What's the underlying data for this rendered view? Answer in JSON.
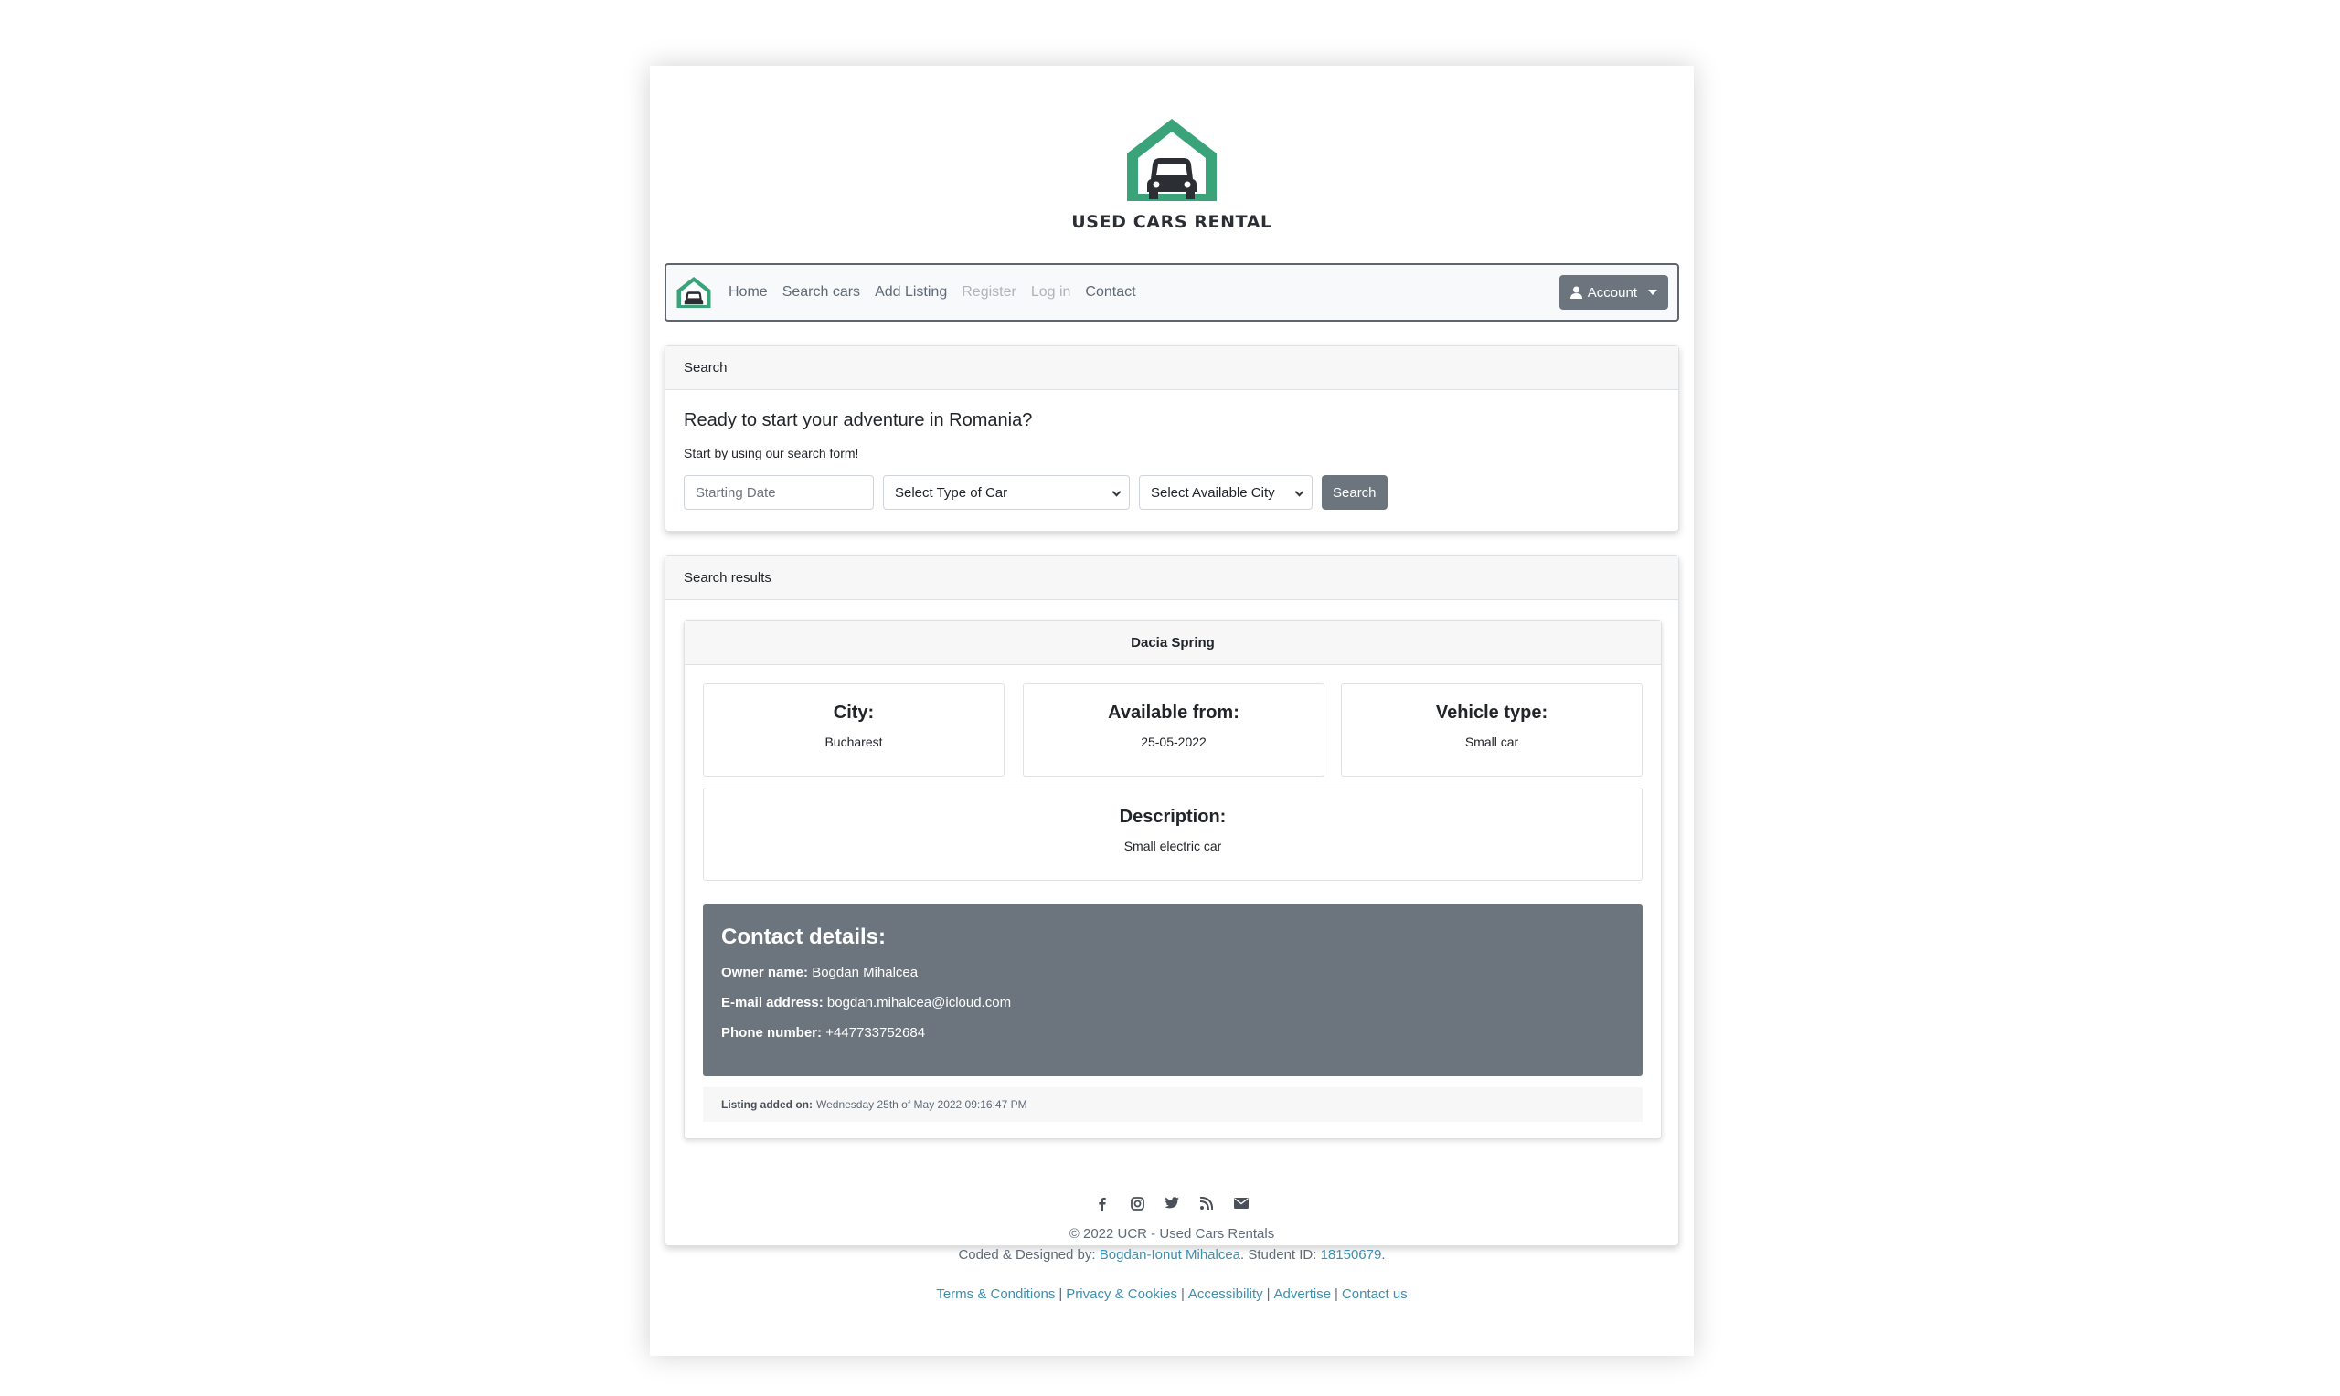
{
  "brand": {
    "name": "USED CARS RENTAL"
  },
  "colors": {
    "brand_green": "#3aa37a",
    "secondary": "#6c757d",
    "link": "#3e8fb0"
  },
  "navbar": {
    "items": [
      {
        "label": "Home",
        "disabled": false
      },
      {
        "label": "Search cars",
        "disabled": false
      },
      {
        "label": "Add Listing",
        "disabled": false
      },
      {
        "label": "Register",
        "disabled": true
      },
      {
        "label": "Log in",
        "disabled": true
      },
      {
        "label": "Contact",
        "disabled": false
      }
    ],
    "account_label": "Account",
    "account_icon": "user-icon"
  },
  "search": {
    "header": "Search",
    "title": "Ready to start your adventure in Romania?",
    "subtitle": "Start by using our search form!",
    "date_placeholder": "Starting Date",
    "car_type_selected": "Select Type of Car",
    "city_selected": "Select Available City",
    "button": "Search"
  },
  "results": {
    "header": "Search results",
    "listing": {
      "title": "Dacia Spring",
      "city_label": "City:",
      "city": "Bucharest",
      "available_label": "Available from:",
      "available": "25-05-2022",
      "type_label": "Vehicle type:",
      "type": "Small car",
      "description_label": "Description:",
      "description": "Small electric car",
      "contact": {
        "title": "Contact details:",
        "owner_label": "Owner name:",
        "owner": "Bogdan Mihalcea",
        "email_label": "E-mail address:",
        "email": "bogdan.mihalcea@icloud.com",
        "phone_label": "Phone number:",
        "phone": "+447733752684"
      },
      "added_label": "Listing added on:",
      "added": "Wednesday 25th of May 2022 09:16:47 PM"
    }
  },
  "footer": {
    "social_icons": [
      "facebook-icon",
      "instagram-icon",
      "twitter-icon",
      "rss-icon",
      "envelope-icon"
    ],
    "copyright": "© 2022 UCR - Used Cars Rentals",
    "coded_prefix": "Coded & Designed by:",
    "author": "Bogdan-Ionut Mihalcea",
    "student_prefix": ". Student ID:",
    "student_id": "18150679",
    "period": ".",
    "links": [
      "Terms & Conditions",
      "Privacy & Cookies",
      "Accessibility",
      "Advertise",
      "Contact us"
    ]
  }
}
